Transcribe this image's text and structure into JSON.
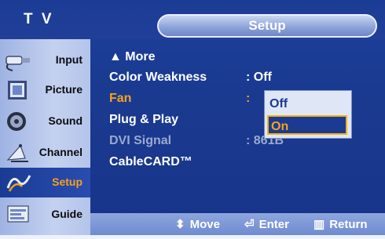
{
  "header": {
    "tv_label": "T V",
    "title": "Setup"
  },
  "sidebar": {
    "items": [
      {
        "label": "Input",
        "icon": "input-plug-icon",
        "active": false
      },
      {
        "label": "Picture",
        "icon": "picture-icon",
        "active": false
      },
      {
        "label": "Sound",
        "icon": "speaker-icon",
        "active": false
      },
      {
        "label": "Channel",
        "icon": "satellite-dish-icon",
        "active": false
      },
      {
        "label": "Setup",
        "icon": "setup-icon",
        "active": true
      },
      {
        "label": "Guide",
        "icon": "guide-icon",
        "active": false
      }
    ]
  },
  "menu": {
    "more_label": "▲ More",
    "rows": [
      {
        "label": "Color Weakness",
        "value": ": Off",
        "state": "normal"
      },
      {
        "label": "Fan",
        "value": ":",
        "state": "highlight"
      },
      {
        "label": "Plug & Play",
        "value": "",
        "state": "normal"
      },
      {
        "label": "DVI Signal",
        "value": ": 861B",
        "state": "dim"
      },
      {
        "label": "CableCARD™",
        "value": "",
        "state": "normal"
      }
    ]
  },
  "dropdown": {
    "options": [
      "Off",
      "On"
    ],
    "selected": "On"
  },
  "footer": {
    "move": "Move",
    "enter": "Enter",
    "return": "Return"
  },
  "colors": {
    "background": "#1a3a90",
    "highlight": "#f5a21c",
    "sidebar": "#c4d1f0",
    "dim_text": "#9aa9cf"
  }
}
